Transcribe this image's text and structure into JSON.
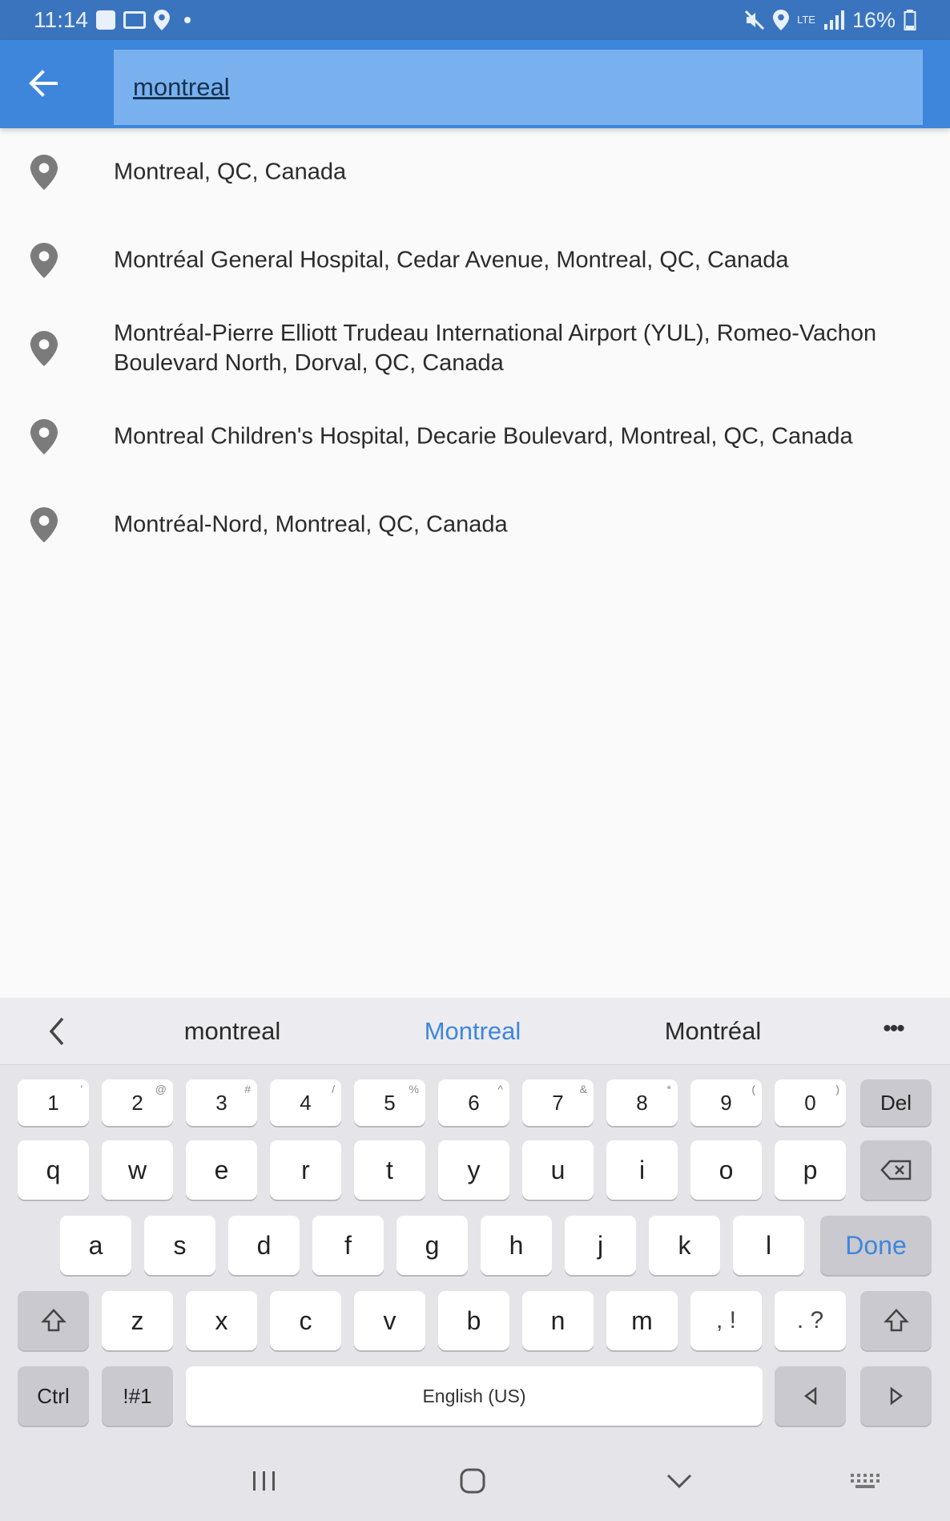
{
  "status_bar": {
    "time": "11:14",
    "battery": "16%",
    "network": "LTE"
  },
  "search": {
    "query": "montreal",
    "back_icon": "arrow-left-icon"
  },
  "results": [
    {
      "text": "Montreal, QC, Canada",
      "icon": "location-pin-icon"
    },
    {
      "text": "Montréal General Hospital, Cedar Avenue, Montreal, QC, Canada",
      "icon": "location-pin-icon"
    },
    {
      "text": "Montréal-Pierre Elliott Trudeau International Airport (YUL), Romeo-Vachon Boulevard North, Dorval, QC, Canada",
      "icon": "location-pin-icon"
    },
    {
      "text": "Montreal Children's Hospital, Decarie Boulevard, Montreal, QC, Canada",
      "icon": "location-pin-icon"
    },
    {
      "text": "Montréal-Nord, Montreal, QC, Canada",
      "icon": "location-pin-icon"
    }
  ],
  "keyboard": {
    "suggestions": [
      "montreal",
      "Montreal",
      "Montréal"
    ],
    "more": "•••",
    "number_row": [
      {
        "k": "1",
        "sup": "'"
      },
      {
        "k": "2",
        "sup": "@"
      },
      {
        "k": "3",
        "sup": "#"
      },
      {
        "k": "4",
        "sup": "/"
      },
      {
        "k": "5",
        "sup": "%"
      },
      {
        "k": "6",
        "sup": "^"
      },
      {
        "k": "7",
        "sup": "&"
      },
      {
        "k": "8",
        "sup": "*"
      },
      {
        "k": "9",
        "sup": "("
      },
      {
        "k": "0",
        "sup": ")"
      }
    ],
    "del_label": "Del",
    "row_q": [
      "q",
      "w",
      "e",
      "r",
      "t",
      "y",
      "u",
      "i",
      "o",
      "p"
    ],
    "row_a": [
      "a",
      "s",
      "d",
      "f",
      "g",
      "h",
      "j",
      "k",
      "l"
    ],
    "done_label": "Done",
    "row_z": [
      "z",
      "x",
      "c",
      "v",
      "b",
      "n",
      "m"
    ],
    "comma_key": ", !",
    "period_key": ". ?",
    "ctrl_label": "Ctrl",
    "symbols_label": "!#1",
    "space_label": "English (US)",
    "accent_color": "#3e86dc"
  },
  "colors": {
    "status_bar": "#3a74be",
    "app_bar": "#3e86dc",
    "search_field": "#79b1ef"
  }
}
